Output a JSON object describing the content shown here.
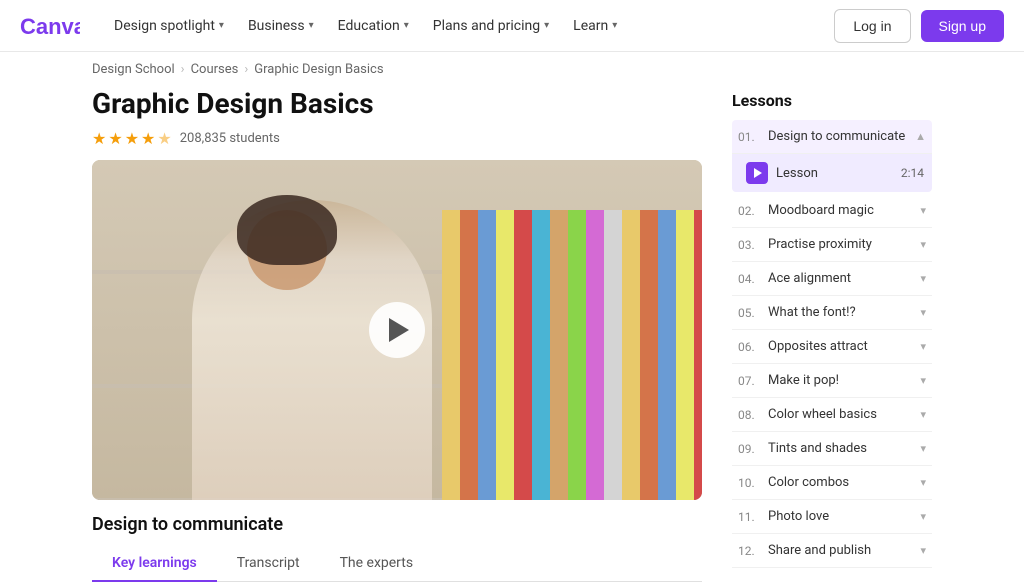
{
  "navbar": {
    "logo_alt": "Canva",
    "links": [
      {
        "label": "Design spotlight",
        "has_chevron": true
      },
      {
        "label": "Business",
        "has_chevron": true
      },
      {
        "label": "Education",
        "has_chevron": true
      },
      {
        "label": "Plans and pricing",
        "has_chevron": true
      },
      {
        "label": "Learn",
        "has_chevron": true
      }
    ],
    "login_label": "Log in",
    "signup_label": "Sign up"
  },
  "breadcrumb": {
    "items": [
      "Design School",
      "Courses",
      "Graphic Design Basics"
    ],
    "sep": "›"
  },
  "course": {
    "title": "Graphic Design Basics",
    "stars": [
      1,
      1,
      1,
      1,
      0.5
    ],
    "student_count": "208,835 students"
  },
  "video": {
    "play_label": "Play"
  },
  "lesson_section": {
    "subtitle": "Design to communicate",
    "tabs": [
      "Key learnings",
      "Transcript",
      "The experts"
    ]
  },
  "lessons_panel": {
    "title": "Lessons",
    "items": [
      {
        "num": "01.",
        "name": "Design to communicate",
        "active": true,
        "sub_lesson": "Lesson",
        "duration": "2:14"
      },
      {
        "num": "02.",
        "name": "Moodboard magic",
        "active": false
      },
      {
        "num": "03.",
        "name": "Practise proximity",
        "active": false
      },
      {
        "num": "04.",
        "name": "Ace alignment",
        "active": false
      },
      {
        "num": "05.",
        "name": "What the font!?",
        "active": false
      },
      {
        "num": "06.",
        "name": "Opposites attract",
        "active": false
      },
      {
        "num": "07.",
        "name": "Make it pop!",
        "active": false
      },
      {
        "num": "08.",
        "name": "Color wheel basics",
        "active": false
      },
      {
        "num": "09.",
        "name": "Tints and shades",
        "active": false
      },
      {
        "num": "10.",
        "name": "Color combos",
        "active": false
      },
      {
        "num": "11.",
        "name": "Photo love",
        "active": false
      },
      {
        "num": "12.",
        "name": "Share and publish",
        "active": false
      }
    ]
  }
}
